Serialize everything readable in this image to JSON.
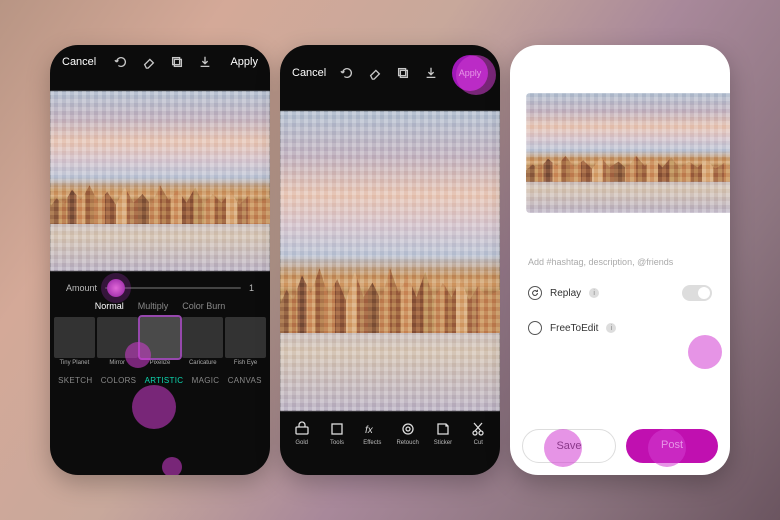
{
  "common": {
    "cancel": "Cancel",
    "apply": "Apply"
  },
  "screen1": {
    "slider": {
      "label": "Amount",
      "value": "1"
    },
    "blend_modes": [
      "Normal",
      "Multiply",
      "Color Burn"
    ],
    "blend_active": 0,
    "effects": [
      {
        "label": "Tiny Planet"
      },
      {
        "label": "Mirror"
      },
      {
        "label": "Pixelize"
      },
      {
        "label": "Caricature"
      },
      {
        "label": "Fish Eye"
      }
    ],
    "effect_selected": 2,
    "categories": [
      "SKETCH",
      "COLORS",
      "ARTISTIC",
      "MAGIC",
      "CANVAS"
    ],
    "category_active": 2
  },
  "screen2": {
    "tools": [
      {
        "label": "Gold"
      },
      {
        "label": "Tools"
      },
      {
        "label": "Effects"
      },
      {
        "label": "Retouch"
      },
      {
        "label": "Sticker"
      },
      {
        "label": "Cut"
      }
    ]
  },
  "screen3": {
    "placeholder": "Add #hashtag, description, @friends",
    "replay_label": "Replay",
    "freetoedit_label": "FreeToEdit",
    "save": "Save",
    "post": "Post"
  }
}
